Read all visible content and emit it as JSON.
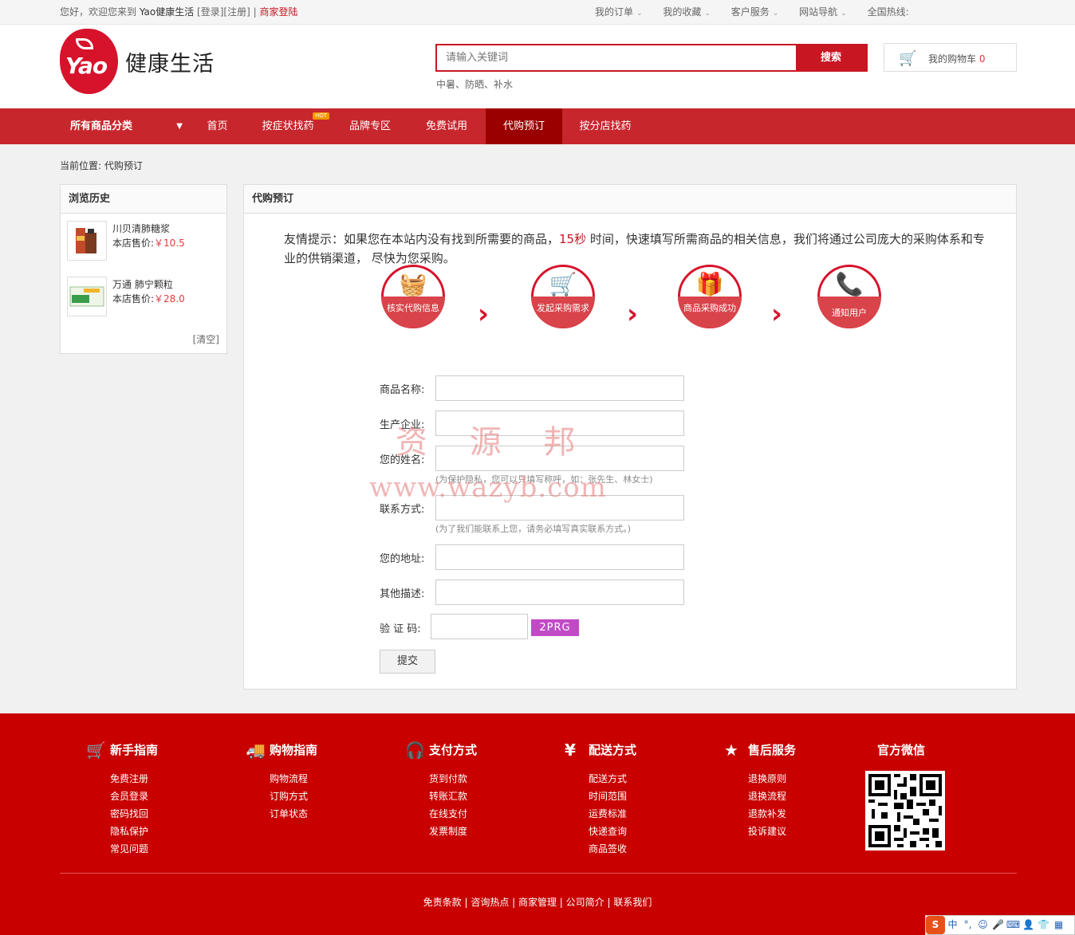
{
  "topbar": {
    "greeting": "您好，欢迎您来到",
    "brand": "Yao健康生活",
    "login": "[登录]",
    "register": "[注册]",
    "sep": "|",
    "seller_login": "商家登陆",
    "links": [
      "我的订单",
      "我的收藏",
      "客户服务",
      "网站导航"
    ],
    "hotline": "全国热线:"
  },
  "header": {
    "logo_text": "Yao",
    "site_name": "健康生活",
    "search_placeholder": "请输入关键词",
    "search_button": "搜索",
    "hot_words": "中暑、防晒、补水",
    "cart_label": "我的购物车",
    "cart_count": "0"
  },
  "nav": {
    "category": "所有商品分类",
    "items": [
      "首页",
      "按症状找药",
      "品牌专区",
      "免费试用",
      "代购预订",
      "按分店找药"
    ],
    "hot_badge": "HOT",
    "active": "代购预订"
  },
  "breadcrumb": "当前位置: 代购预订",
  "history": {
    "title": "浏览历史",
    "products": [
      {
        "name": "川贝清肺糖浆",
        "price_label": "本店售价:",
        "price": "￥10.5"
      },
      {
        "name": "万通 肺宁颗粒",
        "price_label": "本店售价:",
        "price": "￥28.0"
      }
    ],
    "clear": "[清空]"
  },
  "main": {
    "title": "代购预订",
    "tip_a": "友情提示：如果您在本站内没有找到所需要的商品，",
    "tip_seconds": "15秒",
    "tip_b": " 时间，快速填写所需商品的相关信息，我们将通过公司庞大的采购体系和专业的供销渠道， 尽快为您采购。",
    "steps": [
      "核实代购信息",
      "发起采购需求",
      "商品采购成功",
      "通知用户"
    ],
    "arrow": "›",
    "form": {
      "product_name": "商品名称:",
      "manufacturer": "生产企业:",
      "your_name": "您的姓名:",
      "name_note": "(为保护隐私，您可以只填写称呼，如：张先生、林女士)",
      "contact": "联系方式:",
      "contact_note": "(为了我们能联系上您，请务必填写真实联系方式。)",
      "address": "您的地址:",
      "other": "其他描述:",
      "captcha_label": "验 证 码:",
      "captcha_code": "2PRG",
      "submit": "提交"
    },
    "watermark_cn": "资 源 邦",
    "watermark_url": "www.wazyb.com"
  },
  "footer": {
    "columns": [
      {
        "title": "新手指南",
        "icon": "cart-icon",
        "items": [
          "免费注册",
          "会员登录",
          "密码找回",
          "隐私保护",
          "常见问题"
        ]
      },
      {
        "title": "购物指南",
        "icon": "truck-icon",
        "items": [
          "购物流程",
          "订购方式",
          "订单状态"
        ]
      },
      {
        "title": "支付方式",
        "icon": "headphones-icon",
        "items": [
          "货到付款",
          "转账汇款",
          "在线支付",
          "发票制度"
        ]
      },
      {
        "title": "配送方式",
        "icon": "yen-icon",
        "items": [
          "配送方式",
          "时间范围",
          "运费标准",
          "快递查询",
          "商品签收"
        ]
      },
      {
        "title": "售后服务",
        "icon": "star-icon",
        "items": [
          "退换原则",
          "退换流程",
          "退款补发",
          "投诉建议"
        ]
      }
    ],
    "wechat_title": "官方微信",
    "links": "免责条款 | 咨询热点 | 商家管理 | 公司简介 | 联系我们"
  },
  "ime": {
    "logo": "S",
    "lang": "中",
    "punct": "°,"
  },
  "colors": {
    "brand_red": "#c81623",
    "nav_red": "#c8262d",
    "footer_red": "#c80000",
    "active_nav": "#9b0000"
  }
}
